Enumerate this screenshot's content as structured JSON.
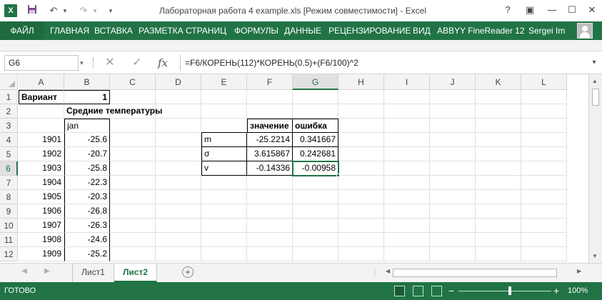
{
  "window": {
    "title": "Лабораторная работа 4 example.xls  [Режим совместимости] - Excel",
    "app_logo": "X",
    "help": "?",
    "ribbon_display": "▣",
    "minimize": "—",
    "maximize": "☐",
    "close": "✕"
  },
  "quick_access": {
    "save_icon": "▪",
    "undo_icon": "↶",
    "redo_icon": "↷",
    "customize_icon": "▾"
  },
  "ribbon": {
    "file_tab": "ФАЙЛ",
    "tabs": [
      "ГЛАВНАЯ",
      "ВСТАВКА",
      "РАЗМЕТКА СТРАНИЦ",
      "ФОРМУЛЫ",
      "ДАННЫЕ",
      "РЕЦЕНЗИРОВАНИЕ",
      "ВИД",
      "ABBYY FineReader 12"
    ],
    "user_name": "Sergei Im"
  },
  "formula_bar": {
    "name_box": "G6",
    "cancel_icon": "✕",
    "enter_icon": "✓",
    "fx_icon": "fx",
    "formula": "=F6/КОРЕНЬ(112)*КОРЕНЬ(0.5)+(F6/100)^2",
    "expand_icon": "▾"
  },
  "grid": {
    "columns": [
      "A",
      "B",
      "C",
      "D",
      "E",
      "F",
      "G",
      "H",
      "I",
      "J",
      "K",
      "L"
    ],
    "selected_column": "G",
    "rows": [
      "1",
      "2",
      "3",
      "4",
      "5",
      "6",
      "7",
      "8",
      "9",
      "10",
      "11",
      "12"
    ],
    "selected_row": "6",
    "cells": {
      "A1": "Вариант",
      "B1": "1",
      "B2": "Средние температуры",
      "B3": "jan",
      "A4": "1901",
      "B4": "-25.6",
      "A5": "1902",
      "B5": "-20.7",
      "A6": "1903",
      "B6": "-25.8",
      "A7": "1904",
      "B7": "-22.3",
      "A8": "1905",
      "B8": "-20.3",
      "A9": "1906",
      "B9": "-26.8",
      "A10": "1907",
      "B10": "-26.3",
      "A11": "1908",
      "B11": "-24.6",
      "A12": "1909",
      "B12": "-25.2",
      "F3": "значение",
      "G3": "ошибка",
      "E4": "m",
      "F4": "-25.2214",
      "G4": "0.341667",
      "E5": "σ",
      "F5": "3.615867",
      "G5": "0.242681",
      "E6": "v",
      "F6": "-0.14336",
      "G6": "-0.00958"
    },
    "active_cell": "G6"
  },
  "sheets": {
    "nav_prev": "◀",
    "nav_next": "▶",
    "tabs": [
      "Лист1",
      "Лист2"
    ],
    "active": "Лист2",
    "add_icon": "+",
    "split_icon": "⋮"
  },
  "scrollbars": {
    "up": "▲",
    "down": "▼",
    "left": "◀",
    "right": "▶"
  },
  "status": {
    "text": "ГОТОВО",
    "zoom_minus": "−",
    "zoom_plus": "+",
    "zoom": "100%",
    "zoom_fraction": 0.55
  }
}
